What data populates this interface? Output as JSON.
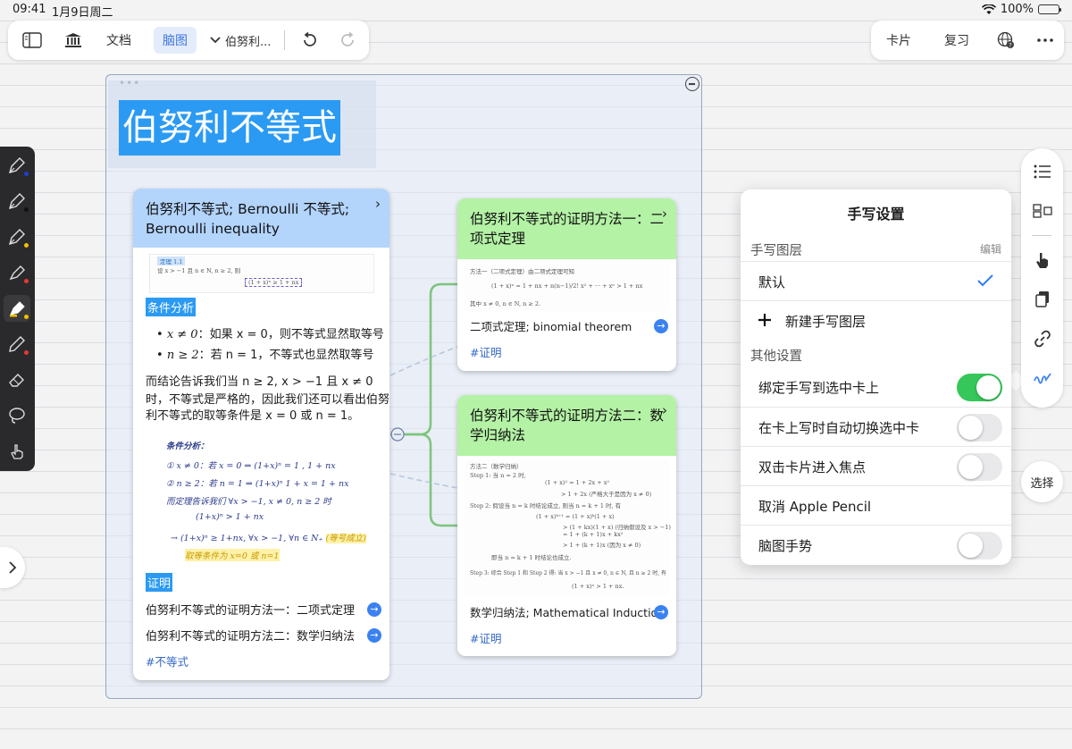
{
  "status_bar": {
    "time": "09:41",
    "date": "1月9日周二",
    "battery": "100%"
  },
  "toolbar": {
    "doc_tab": "文档",
    "mindmap_tab": "脑图",
    "doc_name": "伯努利...",
    "card_tab": "卡片",
    "review_tab": "复习"
  },
  "canvas": {
    "title": "伯努利不等式"
  },
  "main_card": {
    "title": "伯努利不等式; Bernoulli 不等式; Bernoulli inequality",
    "thumb_tag": "定理 1.1",
    "thumb_line1": "设 x > −1 且 n ∈ N, n ≥ 2, 则",
    "thumb_line2": "(1 + x)ⁿ ≥ 1 + nx",
    "section_condition": "条件分析",
    "bullet1_math": "x ≠ 0",
    "bullet1_text": "：如果 x = 0，则不等式显然取等号",
    "bullet2_math": "n ≥ 2",
    "bullet2_text": "：若 n = 1，不等式也显然取等号",
    "para_line1": "而结论告诉我们当 n ≥ 2, x > −1 且 x ≠ 0",
    "para_line2": "时，不等式是严格的，因此我们还可以看出伯努",
    "para_line3": "利不等式的取等条件是 x = 0 或 n = 1。",
    "hw_line1": "条件分析：",
    "hw_line2": "① x ≠ 0：若 x = 0 ⇒ (1+x)ⁿ = 1 , 1 + nx",
    "hw_line3": "② n ≥ 2：若 n = 1 ⇒ (1+x)ⁿ  1 + x = 1 + nx",
    "hw_line4": "而定理告诉我们 ∀x > −1,  x ≠ 0, n ≥ 2 时",
    "hw_line5": "(1+x)ⁿ  >  1 + nx",
    "hw_line6": "→ (1+x)ⁿ ≥ 1+nx, ∀x > −1, ∀n ∈ N₊",
    "hw_highlight1": "(等号成立)",
    "hw_highlight2": "取等条件为 x=0 或 n=1",
    "section_proof": "证明",
    "proof_link1": "伯努利不等式的证明方法一：二项式定理",
    "proof_link2": "伯努利不等式的证明方法二：数学归纳法",
    "tag": "#不等式"
  },
  "card_method1": {
    "title": "伯努利不等式的证明方法一：二项式定理",
    "thumb_line1": "方法一（二项式定理）由二项式定理可知",
    "thumb_line2": "(1 + x)ⁿ = 1 + nx + n(n−1)/2! x² + ··· + xⁿ > 1 + nx",
    "thumb_line3": "其中 x ≠ 0, n ∈ N, n ≥ 2.",
    "subtitle": "二项式定理; binomial theorem",
    "tag": "#证明"
  },
  "card_method2": {
    "title": "伯努利不等式的证明方法二：数学归纳法",
    "thumb_line1": "方法二（数学归纳）",
    "thumb_line2": "Step 1: 当 n = 2 时,",
    "thumb_line3": "(1 + x)² = 1 + 2x + x²",
    "thumb_line4": "> 1 + 2x  (严格大于是因为 x ≠ 0)",
    "thumb_line5": "Step 2: 假设当 n = k 时结论成立, 则当 n = k + 1 时, 有",
    "thumb_line6": "(1 + x)ᵏ⁺¹ = (1 + x)ᵏ(1 + x)",
    "thumb_line7": "> (1 + kx)(1 + x)   (归纳假设及 x > −1)",
    "thumb_line8": "= 1 + (k + 1)x + kx²",
    "thumb_line9": "> 1 + (k + 1)x   (因为 x ≠ 0)",
    "thumb_line10": "即当 n = k + 1 时结论也成立.",
    "thumb_line11": "Step 3: 综合 Step 1 和 Step 2 得: 当 x > −1 且 x ≠ 0, n ∈ N, 且 n ≥ 2 时, 有",
    "thumb_line12": "(1 + x)ⁿ > 1 + nx.",
    "subtitle": "数学归纳法; Mathematical Induction",
    "tag": "#证明"
  },
  "panel": {
    "title": "手写设置",
    "layers_label": "手写图层",
    "edit_label": "编辑",
    "default_layer": "默认",
    "new_layer": "新建手写图层",
    "other_label": "其他设置",
    "bind_label": "绑定手写到选中卡上",
    "bind_on": true,
    "autoswitch_label": "在卡上写时自动切换选中卡",
    "autoswitch_on": false,
    "doubletap_label": "双击卡片进入焦点",
    "doubletap_on": false,
    "cancel_pencil": "取消 Apple Pencil",
    "gesture_label": "脑图手势",
    "gesture_on": false
  },
  "right_toolbar": {
    "select_label": "选择"
  },
  "colors": {
    "accent": "#2b9af3",
    "card_blue_head": "#b3d4fb",
    "card_green_head": "#b4f2a5",
    "connector": "#7cc47c",
    "toggle_on": "#35c759"
  }
}
